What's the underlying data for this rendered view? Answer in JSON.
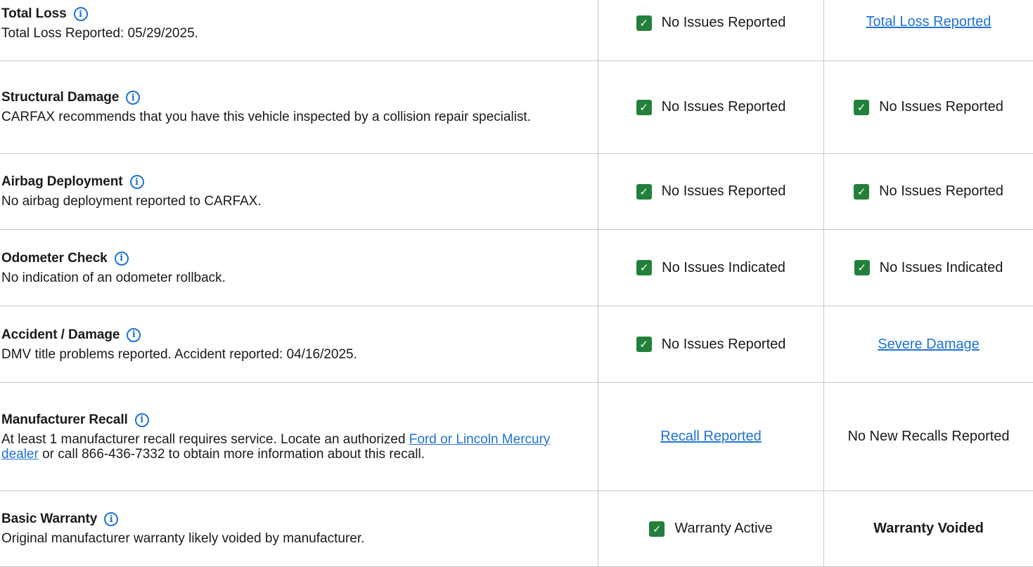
{
  "rows": [
    {
      "title": "Total Loss",
      "desc": "Total Loss Reported: 05/29/2025.",
      "col1": {
        "text": "No Issues Reported"
      },
      "col2": {
        "text": "Total Loss Reported"
      }
    },
    {
      "title": "Structural Damage",
      "desc": "CARFAX recommends that you have this vehicle inspected by a collision repair specialist.",
      "col1": {
        "text": "No Issues Reported"
      },
      "col2": {
        "text": "No Issues Reported"
      }
    },
    {
      "title": "Airbag Deployment",
      "desc": "No airbag deployment reported to CARFAX.",
      "col1": {
        "text": "No Issues Reported"
      },
      "col2": {
        "text": "No Issues Reported"
      }
    },
    {
      "title": "Odometer Check",
      "desc": "No indication of an odometer rollback.",
      "col1": {
        "text": "No Issues Indicated"
      },
      "col2": {
        "text": "No Issues Indicated"
      }
    },
    {
      "title": "Accident / Damage",
      "desc": "DMV title problems reported. Accident reported: 04/16/2025.",
      "col1": {
        "text": "No Issues Reported"
      },
      "col2": {
        "text": "Severe Damage"
      }
    },
    {
      "title": "Manufacturer Recall",
      "desc_before": "At least 1 manufacturer recall requires service. Locate an authorized ",
      "desc_link": "Ford or Lincoln Mercury dealer",
      "desc_after": " or call 866-436-7332 to obtain more information about this recall.",
      "col1": {
        "text": "Recall Reported"
      },
      "col2": {
        "text": "No New Recalls Reported"
      }
    },
    {
      "title": "Basic Warranty",
      "desc": "Original manufacturer warranty likely voided by manufacturer.",
      "col1": {
        "text": "Warranty Active"
      },
      "col2": {
        "text": "Warranty Voided"
      }
    }
  ],
  "icons": {
    "info": "info-circle-icon",
    "check": "checkmark-icon"
  },
  "colors": {
    "check_green": "#23803a",
    "link_blue": "#1f72d6",
    "divider": "#c8c8c8"
  }
}
